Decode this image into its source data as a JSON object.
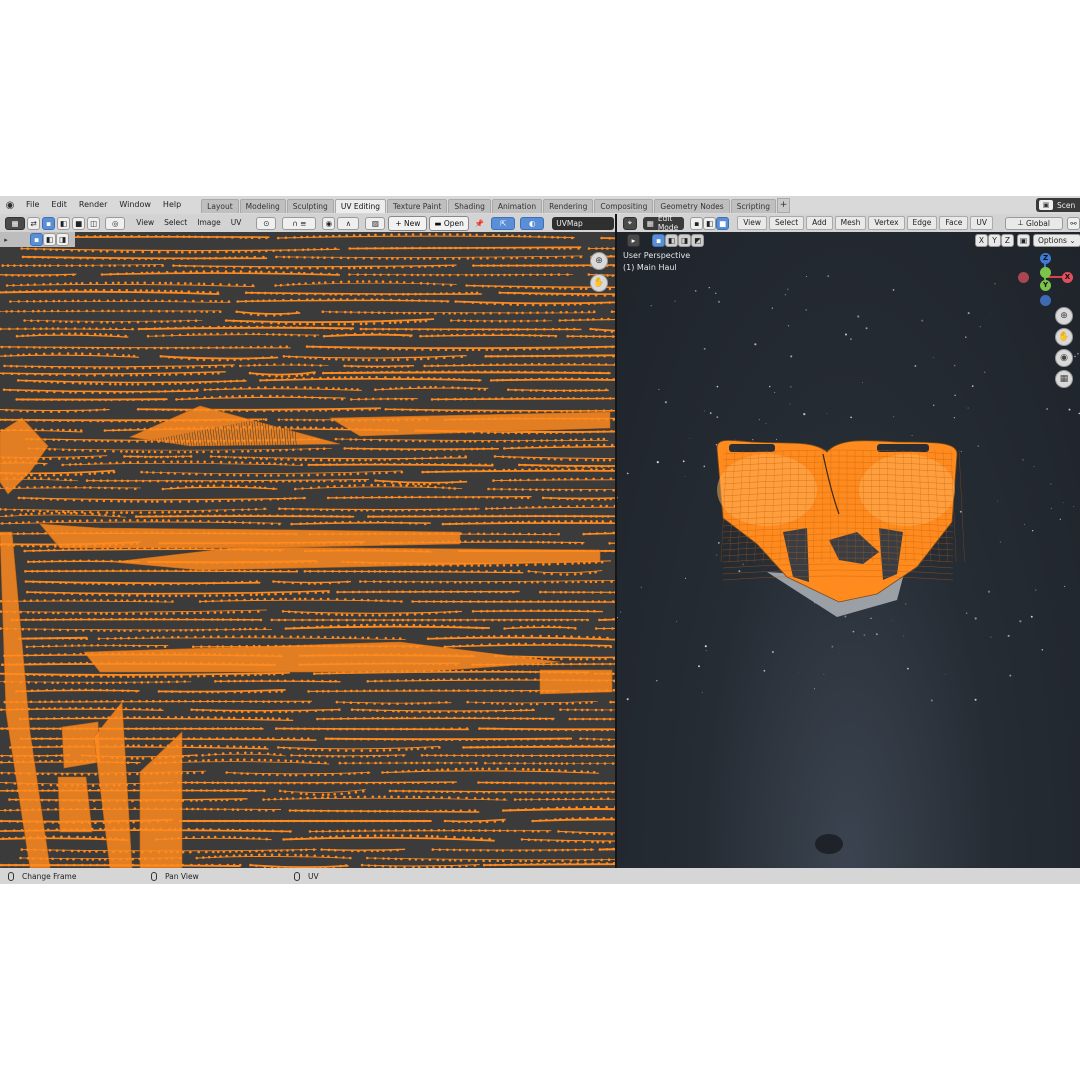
{
  "app": {
    "menu": [
      "File",
      "Edit",
      "Render",
      "Window",
      "Help"
    ],
    "workspace_tabs": [
      "Layout",
      "Modeling",
      "Sculpting",
      "UV Editing",
      "Texture Paint",
      "Shading",
      "Animation",
      "Rendering",
      "Compositing",
      "Geometry Nodes",
      "Scripting"
    ],
    "active_workspace": "UV Editing",
    "add_tab": "+",
    "scene_label": "Scen"
  },
  "uv_editor": {
    "menus": [
      "View",
      "Select",
      "Image",
      "UV"
    ],
    "new_label": "New",
    "open_label": "Open",
    "uvmap_name": "UVMap",
    "accent": "#ff8a1e"
  },
  "viewport": {
    "mode_label": "Edit Mode",
    "menus": [
      "View",
      "Select",
      "Add",
      "Mesh",
      "Vertex",
      "Edge",
      "Face",
      "UV"
    ],
    "transform_orientation": "Global",
    "axis_toggles": [
      "X",
      "Y",
      "Z"
    ],
    "options_label": "Options",
    "perspective_label": "User Perspective",
    "object_label": "(1) Main Haul",
    "gizmo": {
      "z": "Z",
      "y": "Y",
      "x": "X"
    }
  },
  "statusbar": {
    "items": [
      "Change Frame",
      "Pan View",
      "UV"
    ]
  }
}
